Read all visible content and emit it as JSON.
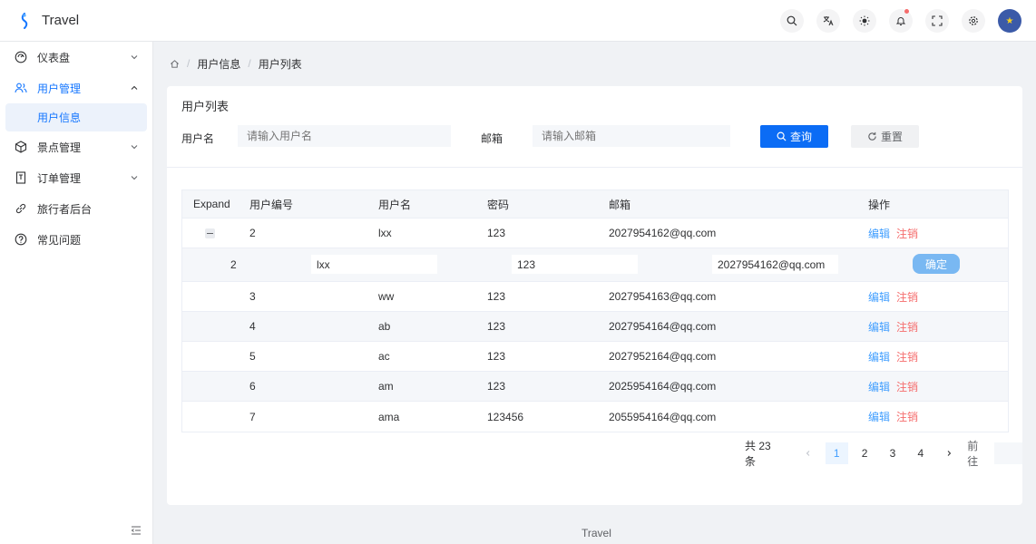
{
  "app": {
    "title": "Travel"
  },
  "header": {
    "icons": [
      "search-icon",
      "translate-icon",
      "theme-icon",
      "bell-icon",
      "fullscreen-icon",
      "settings-icon"
    ],
    "notification_dot_color": "#f56c6c"
  },
  "sidebar": {
    "items": [
      {
        "label": "仪表盘",
        "icon": "dashboard-icon"
      },
      {
        "label": "用户管理",
        "icon": "users-icon",
        "expanded": true
      },
      {
        "label": "用户信息",
        "sub": true,
        "active": true
      },
      {
        "label": "景点管理",
        "icon": "box-icon"
      },
      {
        "label": "订单管理",
        "icon": "order-icon"
      },
      {
        "label": "旅行者后台",
        "icon": "link-icon"
      },
      {
        "label": "常见问题",
        "icon": "help-icon"
      }
    ]
  },
  "breadcrumb": {
    "parent": "用户信息",
    "current": "用户列表",
    "separator": "/"
  },
  "card": {
    "title": "用户列表",
    "search": {
      "username_label": "用户名",
      "username_placeholder": "请输入用户名",
      "email_label": "邮箱",
      "email_placeholder": "请输入邮箱",
      "query_label": "查询",
      "reset_label": "重置"
    }
  },
  "table": {
    "columns": [
      "Expand",
      "用户编号",
      "用户名",
      "密码",
      "邮箱",
      "操作"
    ],
    "edit_label": "编辑",
    "delete_label": "注销",
    "rows": [
      {
        "id": "2",
        "name": "lxx",
        "password": "123",
        "email": "2027954162@qq.com"
      },
      {
        "id": "3",
        "name": "ww",
        "password": "123",
        "email": "2027954163@qq.com"
      },
      {
        "id": "4",
        "name": "ab",
        "password": "123",
        "email": "2027954164@qq.com"
      },
      {
        "id": "5",
        "name": "ac",
        "password": "123",
        "email": "2027952164@qq.com"
      },
      {
        "id": "6",
        "name": "am",
        "password": "123",
        "email": "2025954164@qq.com"
      },
      {
        "id": "7",
        "name": "ama",
        "password": "123456",
        "email": "2055954164@qq.com"
      }
    ],
    "expanded": {
      "id": "2",
      "name": "lxx",
      "password": "123",
      "email": "2027954162@qq.com",
      "confirm_label": "确定"
    }
  },
  "pagination": {
    "total_text": "共 23 条",
    "pages": [
      "1",
      "2",
      "3",
      "4"
    ],
    "current": "1",
    "goto_label": "前往"
  },
  "footer": {
    "text": "Travel"
  },
  "colors": {
    "primary": "#0b6cf5",
    "link": "#409eff",
    "danger": "#f56c6c"
  }
}
